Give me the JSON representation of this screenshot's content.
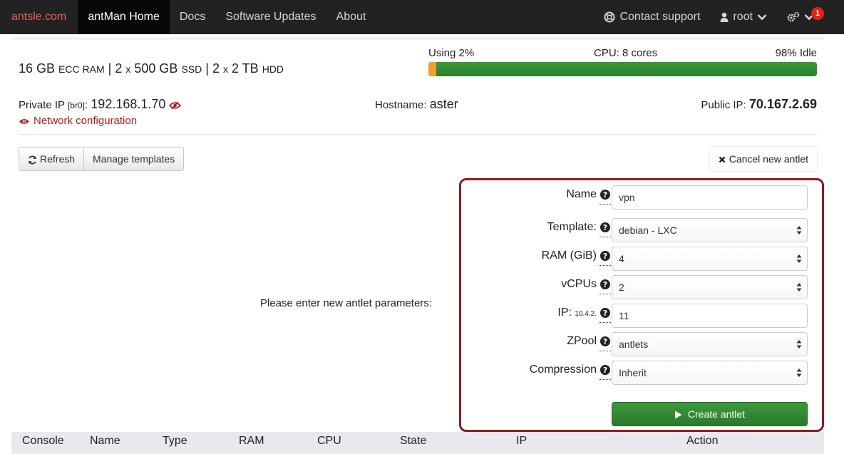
{
  "nav": {
    "brand": "antsle.com",
    "items": [
      {
        "label": "antMan Home",
        "active": true
      },
      {
        "label": "Docs",
        "active": false
      },
      {
        "label": "Software Updates",
        "active": false
      },
      {
        "label": "About",
        "active": false
      }
    ],
    "contact_support": "Contact support",
    "user": "root",
    "notification_count": "1",
    "icons": {
      "support": "lifebuoy-icon",
      "user": "user-icon",
      "settings": "gears-icon",
      "dropdown": "chevron-down-icon"
    }
  },
  "specs": {
    "ram_size": "16 GB",
    "ram_type": "ECC RAM",
    "sep": "|",
    "ssd_count": "2",
    "x": "x",
    "ssd_size": "500 GB",
    "ssd_type": "SSD",
    "hdd_count": "2",
    "hdd_size": "2 TB",
    "hdd_type": "HDD"
  },
  "usage": {
    "using_label": "Using 2%",
    "cpu_label": "CPU: 8 cores",
    "idle_label": "98% Idle",
    "used_percent": 2,
    "idle_percent": 98,
    "used_color": "#f0a030",
    "idle_color": "#2e8b2e"
  },
  "network": {
    "private_ip_label": "Private IP",
    "private_ip_iface": "[br0]",
    "private_ip_colon": ":",
    "private_ip": "192.168.1.70",
    "network_config": "Network configuration",
    "hostname_label": "Hostname:",
    "hostname": "aster",
    "public_ip_label": "Public IP:",
    "public_ip": "70.167.2.69"
  },
  "toolbar": {
    "refresh": "Refresh",
    "manage_templates": "Manage templates",
    "cancel": "Cancel new antlet"
  },
  "prompt": "Please enter new antlet parameters:",
  "form": {
    "name_label": "Name",
    "name_value": "vpn",
    "template_label": "Template:",
    "template_value": "debian - LXC",
    "ram_label": "RAM (GiB)",
    "ram_value": "4",
    "vcpus_label": "vCPUs",
    "vcpus_value": "2",
    "ip_label": "IP:",
    "ip_prefix": "10.4.2.",
    "ip_value": "11",
    "zpool_label": "ZPool",
    "zpool_value": "antlets",
    "compression_label": "Compression",
    "compression_value": "Inherit",
    "create": "Create antlet",
    "border_color": "#8b1c24",
    "create_color": "#2e8b2e"
  },
  "table": {
    "columns": [
      "Console",
      "Name",
      "Type",
      "RAM",
      "CPU",
      "State",
      "IP",
      "Action"
    ]
  }
}
